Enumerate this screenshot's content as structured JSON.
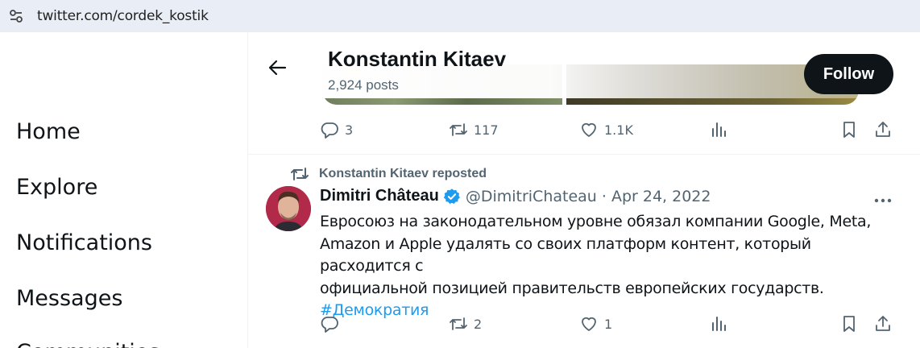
{
  "browser": {
    "url": "twitter.com/cordek_kostik"
  },
  "sidebar": {
    "items": [
      {
        "label": "Home"
      },
      {
        "label": "Explore"
      },
      {
        "label": "Notifications"
      },
      {
        "label": "Messages"
      },
      {
        "label": "Communities"
      }
    ]
  },
  "header": {
    "name": "Konstantin Kitaev",
    "posts": "2,924 posts",
    "follow_label": "Follow"
  },
  "tweet1": {
    "replies": "3",
    "retweets": "117",
    "likes": "1.1K"
  },
  "tweet2": {
    "repost_label": "Konstantin Kitaev reposted",
    "author_name": "Dimitri Château",
    "handle_date": "@DimitriChateau · Apr 24, 2022",
    "text_lines": [
      "Евросоюз на законодательном уровне обязал компании Google, Meta,",
      "Amazon и Apple удалять со своих платформ контент, который расходится с",
      "официальной позицией правительств европейских государств."
    ],
    "hashtag": "#Демократия",
    "replies": "",
    "retweets": "2",
    "likes": "1"
  },
  "colors": {
    "accent": "#1d9bf0",
    "text": "#0f1419",
    "muted": "#536471",
    "follow_bg": "#0f1419"
  },
  "icons": [
    "tune-icon",
    "back-arrow-icon",
    "reply-icon",
    "retweet-icon",
    "like-icon",
    "views-icon",
    "bookmark-icon",
    "share-icon",
    "verified-icon",
    "more-icon"
  ]
}
